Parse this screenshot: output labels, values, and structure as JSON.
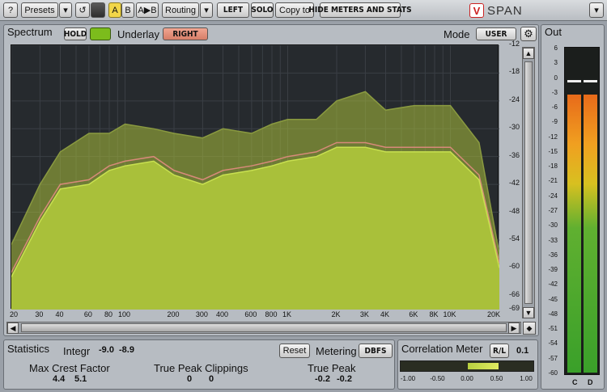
{
  "toolbar": {
    "help": "?",
    "presets": "Presets",
    "presets_arrow": "▾",
    "undo": "↺",
    "a": "A",
    "b": "B",
    "ab": "A▶B",
    "routing": "Routing",
    "routing_arrow": "▾",
    "left": "LEFT",
    "solo": "SOLO",
    "copy_to": "Copy to",
    "hide_meters": "HIDE METERS AND STATS",
    "brand": "SPAN",
    "close": "▾"
  },
  "spectrum": {
    "title": "Spectrum",
    "hold": "HOLD",
    "underlay_label": "Underlay",
    "underlay_value": "RIGHT",
    "mode_label": "Mode",
    "mode_value": "USER"
  },
  "yaxis": [
    "-12",
    "-18",
    "-24",
    "-30",
    "-36",
    "-42",
    "-48",
    "-54",
    "-60",
    "-66",
    "-69"
  ],
  "xaxis": [
    "20",
    "30",
    "40",
    "60",
    "80",
    "100",
    "200",
    "300",
    "400",
    "600",
    "800",
    "1K",
    "2K",
    "3K",
    "4K",
    "6K",
    "8K",
    "10K",
    "20K"
  ],
  "chart_data": {
    "type": "area",
    "xlabel": "",
    "ylabel": "",
    "xscale": "log",
    "xlim": [
      20,
      20000
    ],
    "ylim": [
      -69,
      -12
    ],
    "series": [
      {
        "role": "main",
        "x": [
          20,
          30,
          40,
          60,
          80,
          100,
          150,
          200,
          300,
          400,
          600,
          800,
          1000,
          1500,
          2000,
          3000,
          4000,
          6000,
          8000,
          10000,
          15000,
          20000
        ],
        "values": [
          -62,
          -50,
          -43,
          -42,
          -39,
          -38,
          -37,
          -40,
          -42,
          -40,
          -39,
          -38,
          -37,
          -36,
          -34,
          -34,
          -35,
          -35,
          -35,
          -35,
          -41,
          -60
        ]
      },
      {
        "role": "hold",
        "x": [
          20,
          30,
          40,
          60,
          80,
          100,
          150,
          200,
          300,
          400,
          600,
          800,
          1000,
          1500,
          2000,
          3000,
          4000,
          6000,
          8000,
          10000,
          15000,
          20000
        ],
        "values": [
          -55,
          -42,
          -35,
          -31,
          -31,
          -29,
          -30,
          -31,
          -32,
          -30,
          -31,
          -29,
          -28,
          -28,
          -24,
          -22,
          -26,
          -25,
          -25,
          -25,
          -33,
          -57
        ]
      },
      {
        "role": "underlay-right",
        "x": [
          20,
          30,
          40,
          60,
          80,
          100,
          150,
          200,
          300,
          400,
          600,
          800,
          1000,
          1500,
          2000,
          3000,
          4000,
          6000,
          8000,
          10000,
          15000,
          20000
        ],
        "values": [
          -61,
          -49,
          -42,
          -41,
          -38,
          -37,
          -36,
          -39,
          -41,
          -39,
          -38,
          -37,
          -36,
          -35,
          -33,
          -33,
          -34,
          -34,
          -34,
          -34,
          -40,
          -59
        ]
      }
    ]
  },
  "statistics": {
    "title": "Statistics",
    "integr_label": "Integr",
    "integr_l": "-9.0",
    "integr_r": "-8.9",
    "reset": "Reset",
    "metering_label": "Metering",
    "metering_value": "DBFS",
    "crest_label": "Max Crest Factor",
    "crest_l": "4.4",
    "crest_r": "5.1",
    "tpc_label": "True Peak Clippings",
    "tpc_l": "0",
    "tpc_r": "0",
    "tp_label": "True Peak",
    "tp_l": "-0.2",
    "tp_r": "-0.2"
  },
  "correlation": {
    "title": "Correlation Meter",
    "mode": "R/L",
    "value": "0.1",
    "scale": [
      "-1.00",
      "-0.50",
      "0.00",
      "0.50",
      "1.00"
    ],
    "level": 0.1
  },
  "output": {
    "title": "Out",
    "scale": [
      "6",
      "3",
      "0",
      "-3",
      "-6",
      "-9",
      "-12",
      "-15",
      "-18",
      "-21",
      "-24",
      "-27",
      "-30",
      "-33",
      "-36",
      "-39",
      "-42",
      "-45",
      "-48",
      "-51",
      "-54",
      "-57",
      "-60"
    ],
    "left_label": "C",
    "right_label": "D",
    "peak_db": -0.2,
    "rms_db": -3.5
  }
}
